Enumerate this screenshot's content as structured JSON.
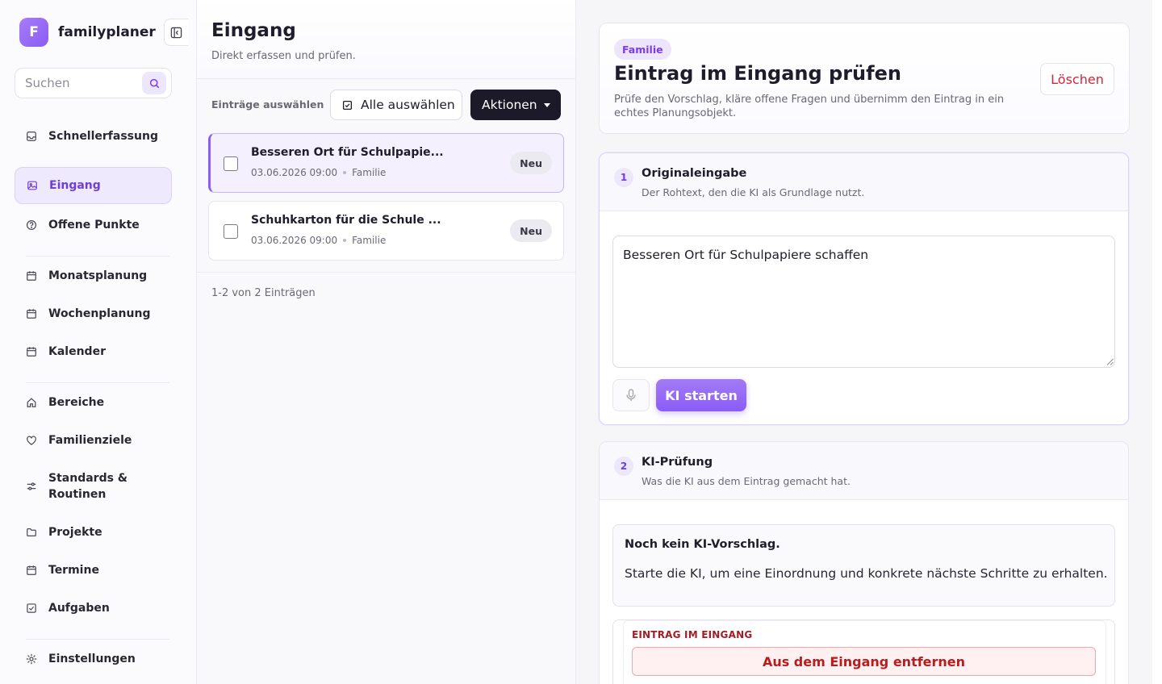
{
  "app": {
    "logo_letter": "F",
    "name": "familyplaner",
    "brand_color": "#8b5cf6"
  },
  "search": {
    "placeholder": "Suchen"
  },
  "sidebar": {
    "items": [
      {
        "label": "Schnellerfassung",
        "icon": "inbox-icon"
      },
      {
        "label": "Eingang",
        "icon": "image-icon",
        "active": true
      },
      {
        "label": "Offene Punkte",
        "icon": "help-circle-icon"
      },
      {
        "label": "Monatsplanung",
        "icon": "calendar-icon"
      },
      {
        "label": "Wochenplanung",
        "icon": "calendar-icon"
      },
      {
        "label": "Kalender",
        "icon": "calendar-icon"
      },
      {
        "label": "Bereiche",
        "icon": "home-icon"
      },
      {
        "label": "Familienziele",
        "icon": "heart-icon"
      },
      {
        "label": "Standards & Routinen",
        "icon": "sliders-icon"
      },
      {
        "label": "Projekte",
        "icon": "folder-icon"
      },
      {
        "label": "Termine",
        "icon": "calendar-icon"
      },
      {
        "label": "Aufgaben",
        "icon": "check-square-icon"
      },
      {
        "label": "Einstellungen",
        "icon": "settings-icon"
      }
    ]
  },
  "inbox": {
    "title": "Eingang",
    "subtitle": "Direkt erfassen und prüfen.",
    "select_label": "Einträge auswählen",
    "select_all": "Alle auswählen",
    "actions": "Aktionen",
    "entries": [
      {
        "title": "Besseren Ort für Schulpapie...",
        "date": "03.06.2026 09:00",
        "category": "Familie",
        "status": "Neu",
        "selected": true
      },
      {
        "title": "Schuhkarton für die Schule ...",
        "date": "03.06.2026 09:00",
        "category": "Familie",
        "status": "Neu",
        "selected": false
      }
    ],
    "count_text": "1-2 von 2 Einträgen"
  },
  "detail": {
    "tag": "Familie",
    "title": "Eintrag im Eingang prüfen",
    "description": "Prüfe den Vorschlag, kläre offene Fragen und übernimm den Eintrag in ein echtes Planungsobjekt.",
    "delete": "Löschen",
    "step1": {
      "number": "1",
      "title": "Originaleingabe",
      "subtitle": "Der Rohtext, den die KI als Grundlage nutzt.",
      "text": "Besseren Ort für Schulpapiere schaffen",
      "start_ki": "KI starten"
    },
    "step2": {
      "number": "2",
      "title": "KI-Prüfung",
      "subtitle": "Was die KI aus dem Eintrag gemacht hat.",
      "notice_title": "Noch kein KI-Vorschlag.",
      "notice_text": "Starte die KI, um eine Einordnung und konkrete nächste Schritte zu erhalten.",
      "inbox_label": "EINTRAG IM EINGANG",
      "remove": "Aus dem Eingang entfernen"
    }
  }
}
